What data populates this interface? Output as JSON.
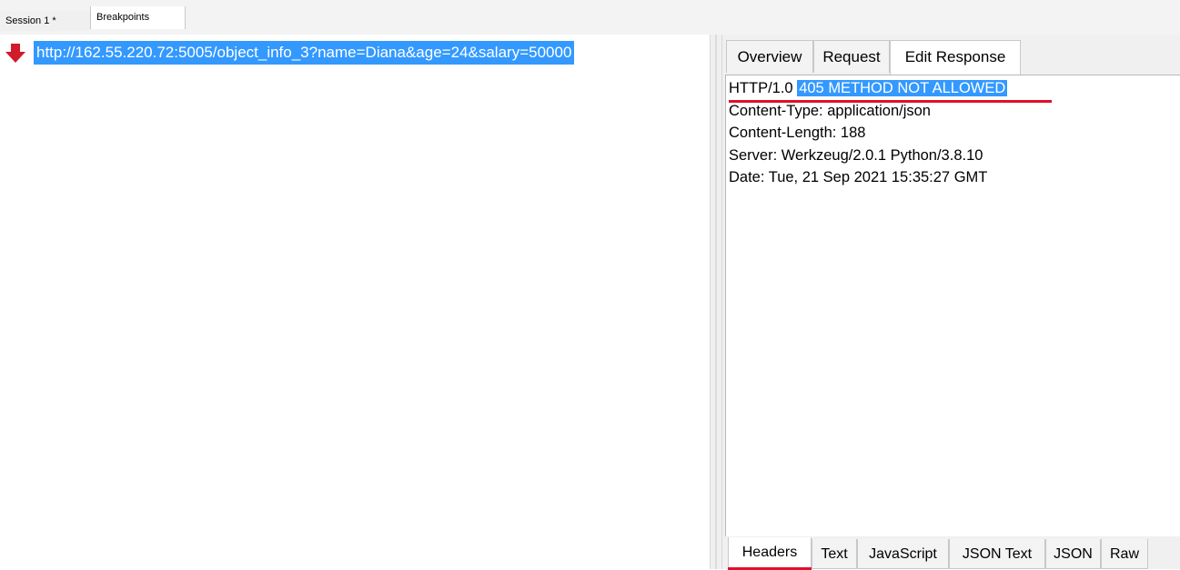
{
  "session_tabs": [
    {
      "label": "Session 1 *"
    },
    {
      "label": "Breakpoints"
    }
  ],
  "breakpoint": {
    "url": "http://162.55.220.72:5005/object_info_3?name=Diana&age=24&salary=50000"
  },
  "response_tabs": [
    {
      "label": "Overview"
    },
    {
      "label": "Request"
    },
    {
      "label": "Edit Response"
    }
  ],
  "response": {
    "protocol": "HTTP/1.0",
    "status": "405 METHOD NOT ALLOWED",
    "headers": [
      "Content-Type: application/json",
      "Content-Length: 188",
      "Server: Werkzeug/2.0.1 Python/3.8.10",
      "Date: Tue, 21 Sep 2021 15:35:27 GMT"
    ]
  },
  "body_tabs": [
    {
      "label": "Headers"
    },
    {
      "label": "Text"
    },
    {
      "label": "JavaScript"
    },
    {
      "label": "JSON Text"
    },
    {
      "label": "JSON"
    },
    {
      "label": "Raw"
    }
  ],
  "colors": {
    "selection": "#3399ff",
    "annotation_red": "#e0102a",
    "breakpoint_arrow": "#d11a2a"
  }
}
